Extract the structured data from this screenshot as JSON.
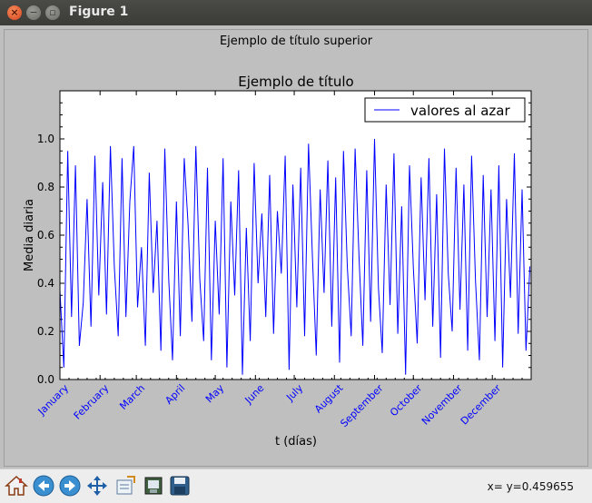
{
  "window": {
    "title": "Figure 1"
  },
  "figure": {
    "suptitle": "Ejemplo de título superior"
  },
  "toolbar": {
    "buttons": [
      "home-icon",
      "back-icon",
      "forward-icon",
      "pan-icon",
      "subplots-icon",
      "configure-icon",
      "save-icon"
    ],
    "coords": "x= y=0.459655"
  },
  "colors": {
    "line": "#0000ff",
    "ticklabel": "#0000ff",
    "axes_bg": "#ffffff",
    "figure_bg": "#bfbfbf"
  },
  "chart_data": {
    "type": "line",
    "title": "Ejemplo de título",
    "xlabel": "t (días)",
    "ylabel": "Media diaria",
    "ylim": [
      0,
      1.2
    ],
    "xlim": [
      1,
      365
    ],
    "yticks": [
      "0.0",
      "0.2",
      "0.4",
      "0.6",
      "0.8",
      "1.0"
    ],
    "month_labels": [
      "January",
      "February",
      "March",
      "April",
      "May",
      "June",
      "July",
      "August",
      "September",
      "October",
      "November",
      "December"
    ],
    "month_positions": [
      1,
      32,
      60,
      91,
      121,
      152,
      182,
      213,
      244,
      274,
      305,
      335
    ],
    "legend": {
      "label": "valores al azar",
      "position": "top-right"
    },
    "series": [
      {
        "name": "valores al azar",
        "x": [
          1,
          4,
          7,
          10,
          13,
          16,
          19,
          22,
          25,
          28,
          31,
          34,
          37,
          40,
          43,
          46,
          49,
          52,
          55,
          58,
          61,
          64,
          67,
          70,
          73,
          76,
          79,
          82,
          85,
          88,
          91,
          94,
          97,
          100,
          103,
          106,
          109,
          112,
          115,
          118,
          121,
          124,
          127,
          130,
          133,
          136,
          139,
          142,
          145,
          148,
          151,
          154,
          157,
          160,
          163,
          166,
          169,
          172,
          175,
          178,
          181,
          184,
          187,
          190,
          193,
          196,
          199,
          202,
          205,
          208,
          211,
          214,
          217,
          220,
          223,
          226,
          229,
          232,
          235,
          238,
          241,
          244,
          247,
          250,
          253,
          256,
          259,
          262,
          265,
          268,
          271,
          274,
          277,
          280,
          283,
          286,
          289,
          292,
          295,
          298,
          301,
          304,
          307,
          310,
          313,
          316,
          319,
          322,
          325,
          328,
          331,
          334,
          337,
          340,
          343,
          346,
          349,
          352,
          355,
          358,
          361,
          364
        ],
        "values": [
          0.37,
          0.05,
          0.95,
          0.26,
          0.89,
          0.14,
          0.32,
          0.75,
          0.22,
          0.93,
          0.35,
          0.82,
          0.27,
          0.97,
          0.47,
          0.18,
          0.92,
          0.26,
          0.74,
          0.97,
          0.3,
          0.55,
          0.14,
          0.86,
          0.36,
          0.66,
          0.12,
          0.96,
          0.42,
          0.08,
          0.74,
          0.18,
          0.92,
          0.64,
          0.24,
          0.97,
          0.42,
          0.16,
          0.88,
          0.08,
          0.66,
          0.27,
          0.92,
          0.05,
          0.74,
          0.35,
          0.87,
          0.02,
          0.63,
          0.16,
          0.9,
          0.4,
          0.69,
          0.26,
          0.85,
          0.19,
          0.7,
          0.44,
          0.93,
          0.04,
          0.81,
          0.3,
          0.88,
          0.18,
          0.98,
          0.52,
          0.1,
          0.79,
          0.36,
          0.91,
          0.22,
          0.84,
          0.07,
          0.95,
          0.47,
          0.18,
          0.96,
          0.51,
          0.14,
          0.87,
          0.24,
          1.0,
          0.38,
          0.11,
          0.81,
          0.31,
          0.94,
          0.19,
          0.72,
          0.02,
          0.89,
          0.46,
          0.15,
          0.84,
          0.33,
          0.92,
          0.22,
          0.77,
          0.09,
          0.96,
          0.44,
          0.2,
          0.88,
          0.29,
          0.81,
          0.12,
          0.93,
          0.41,
          0.08,
          0.85,
          0.26,
          0.79,
          0.16,
          0.89,
          0.05,
          0.75,
          0.34,
          0.94,
          0.19,
          0.79,
          0.12,
          0.47
        ]
      }
    ]
  }
}
